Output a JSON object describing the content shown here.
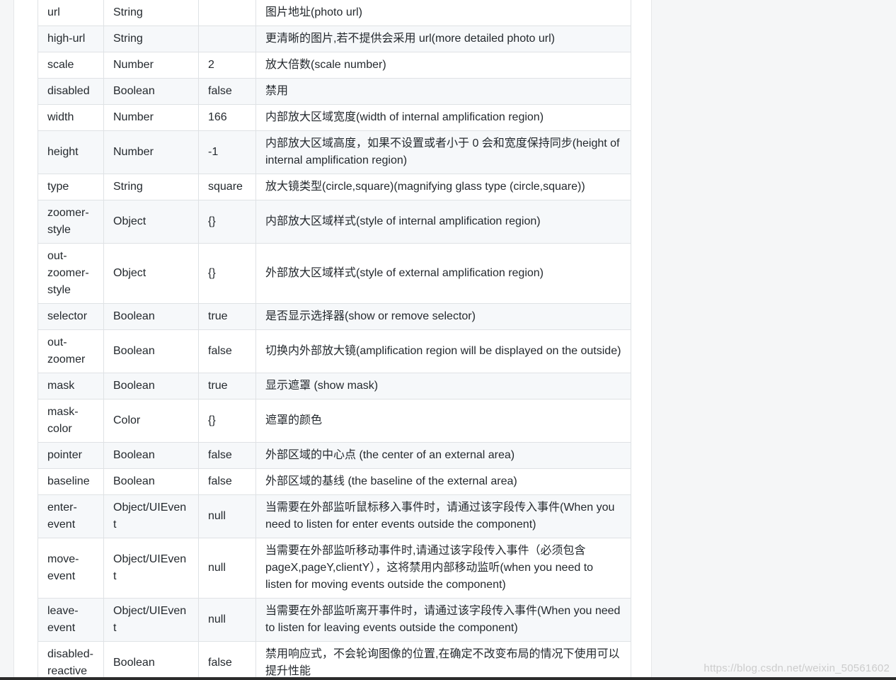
{
  "rows": [
    {
      "name": "url",
      "type": "String",
      "default": "",
      "description": "图片地址(photo url)"
    },
    {
      "name": "high-url",
      "type": "String",
      "default": "",
      "description": "更清晰的图片,若不提供会采用 url(more detailed photo url)"
    },
    {
      "name": "scale",
      "type": "Number",
      "default": "2",
      "description": "放大倍数(scale number)"
    },
    {
      "name": "disabled",
      "type": "Boolean",
      "default": "false",
      "description": "禁用"
    },
    {
      "name": "width",
      "type": "Number",
      "default": "166",
      "description": "内部放大区域宽度(width of internal amplification region)"
    },
    {
      "name": "height",
      "type": "Number",
      "default": "-1",
      "description": "内部放大区域高度，如果不设置或者小于 0 会和宽度保持同步(height of internal amplification region)"
    },
    {
      "name": "type",
      "type": "String",
      "default": "square",
      "description": "放大镜类型(circle,square)(magnifying glass type (circle,square))"
    },
    {
      "name": "zoomer-style",
      "type": "Object",
      "default": "{}",
      "description": "内部放大区域样式(style of internal amplification region)"
    },
    {
      "name": "out-zoomer-style",
      "type": "Object",
      "default": "{}",
      "description": "外部放大区域样式(style of external amplification region)"
    },
    {
      "name": "selector",
      "type": "Boolean",
      "default": "true",
      "description": "是否显示选择器(show or remove selector)"
    },
    {
      "name": "out-zoomer",
      "type": "Boolean",
      "default": "false",
      "description": "切换内外部放大镜(amplification region will be displayed on the outside)"
    },
    {
      "name": "mask",
      "type": "Boolean",
      "default": "true",
      "description": "显示遮罩 (show mask)"
    },
    {
      "name": "mask-color",
      "type": "Color",
      "default": "{}",
      "description": "遮罩的颜色"
    },
    {
      "name": "pointer",
      "type": "Boolean",
      "default": "false",
      "description": "外部区域的中心点 (the center of an external area)"
    },
    {
      "name": "baseline",
      "type": "Boolean",
      "default": "false",
      "description": "外部区域的基线 (the baseline of the external area)"
    },
    {
      "name": "enter-event",
      "type": "Object/UIEvent",
      "default": "null",
      "description": "当需要在外部监听鼠标移入事件时，请通过该字段传入事件(When you need to listen for enter events outside the component)"
    },
    {
      "name": "move-event",
      "type": "Object/UIEvent",
      "default": "null",
      "description": "当需要在外部监听移动事件时,请通过该字段传入事件（必须包含 pageX,pageY,clientY），这将禁用内部移动监听(when you need to listen for moving events outside the component)"
    },
    {
      "name": "leave-event",
      "type": "Object/UIEvent",
      "default": "null",
      "description": "当需要在外部监听离开事件时，请通过该字段传入事件(When you need to listen for leaving events outside the component)"
    },
    {
      "name": "disabled-reactive",
      "type": "Boolean",
      "default": "false",
      "description": "禁用响应式，不会轮询图像的位置,在确定不改变布局的情况下使用可以提升性能"
    }
  ],
  "watermark": "https://blog.csdn.net/weixin_50561602"
}
